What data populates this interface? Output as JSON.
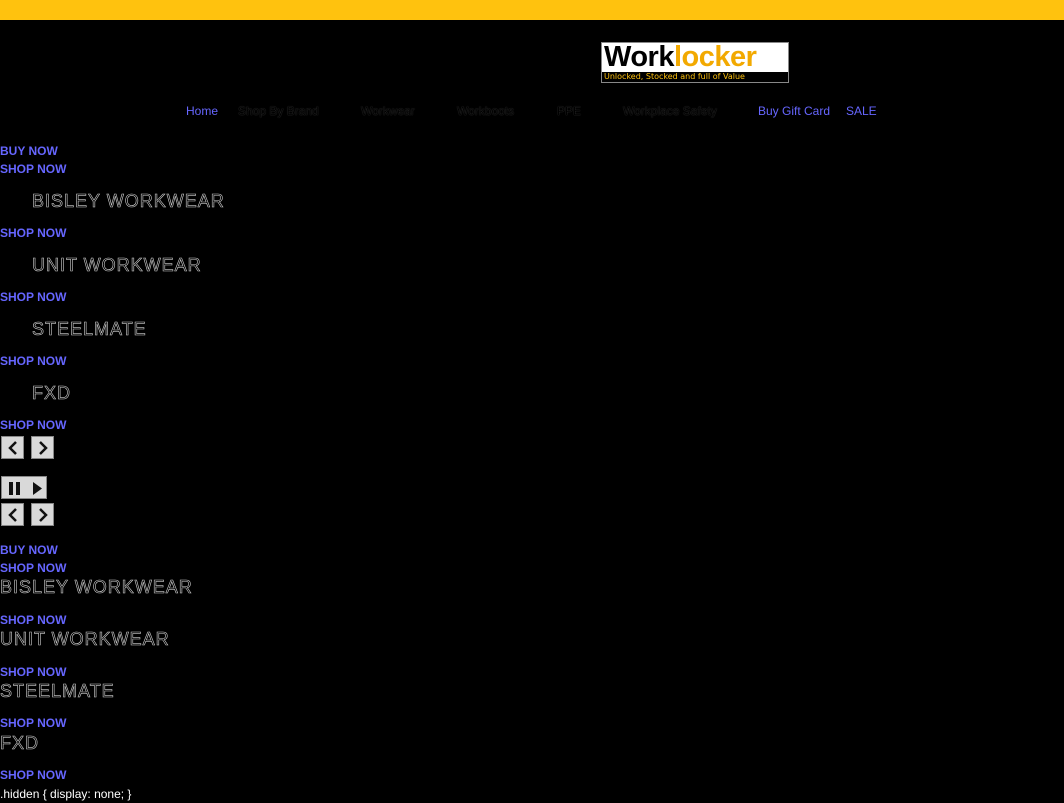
{
  "header": {
    "logo": {
      "word_black": "Work",
      "word_orange": "locker",
      "tagline": "Unlocked, Stocked and full of Value"
    },
    "nav": {
      "home": "Home",
      "shop_by_brand": "Shop By Brand",
      "workwear": "Workwear",
      "workboots": "Workboots",
      "ppe": "PPE",
      "workplace_safety": "Workplace Safety",
      "buy_gift_card": "Buy Gift Card",
      "sale": "SALE"
    }
  },
  "slider_1": {
    "buy_now": "BUY NOW",
    "shop_now_1": "SHOP NOW",
    "slides": [
      {
        "brand": "BISLEY WORKWEAR",
        "cta": "SHOP NOW"
      },
      {
        "brand": "UNIT WORKWEAR",
        "cta": "SHOP NOW"
      },
      {
        "brand": "STEELMATE",
        "cta": "SHOP NOW"
      },
      {
        "brand": "FXD",
        "cta": "SHOP NOW"
      }
    ]
  },
  "slider_2": {
    "buy_now": "BUY NOW",
    "shop_now_1": "SHOP NOW",
    "slides": [
      {
        "brand": "BISLEY WORKWEAR",
        "cta": "SHOP NOW"
      },
      {
        "brand": "UNIT WORKWEAR",
        "cta": "SHOP NOW"
      },
      {
        "brand": "STEELMATE",
        "cta": "SHOP NOW"
      },
      {
        "brand": "FXD",
        "cta": "SHOP NOW"
      }
    ]
  },
  "raw_css_text": ".hidden { display: none; }",
  "colors": {
    "topbar": "#ffc20e",
    "background": "#000000",
    "link": "#6666ff",
    "logo_accent": "#f2a900"
  },
  "icons": {
    "prev": "chevron-left-icon",
    "next": "chevron-right-icon",
    "pause": "pause-icon",
    "play": "play-icon"
  }
}
